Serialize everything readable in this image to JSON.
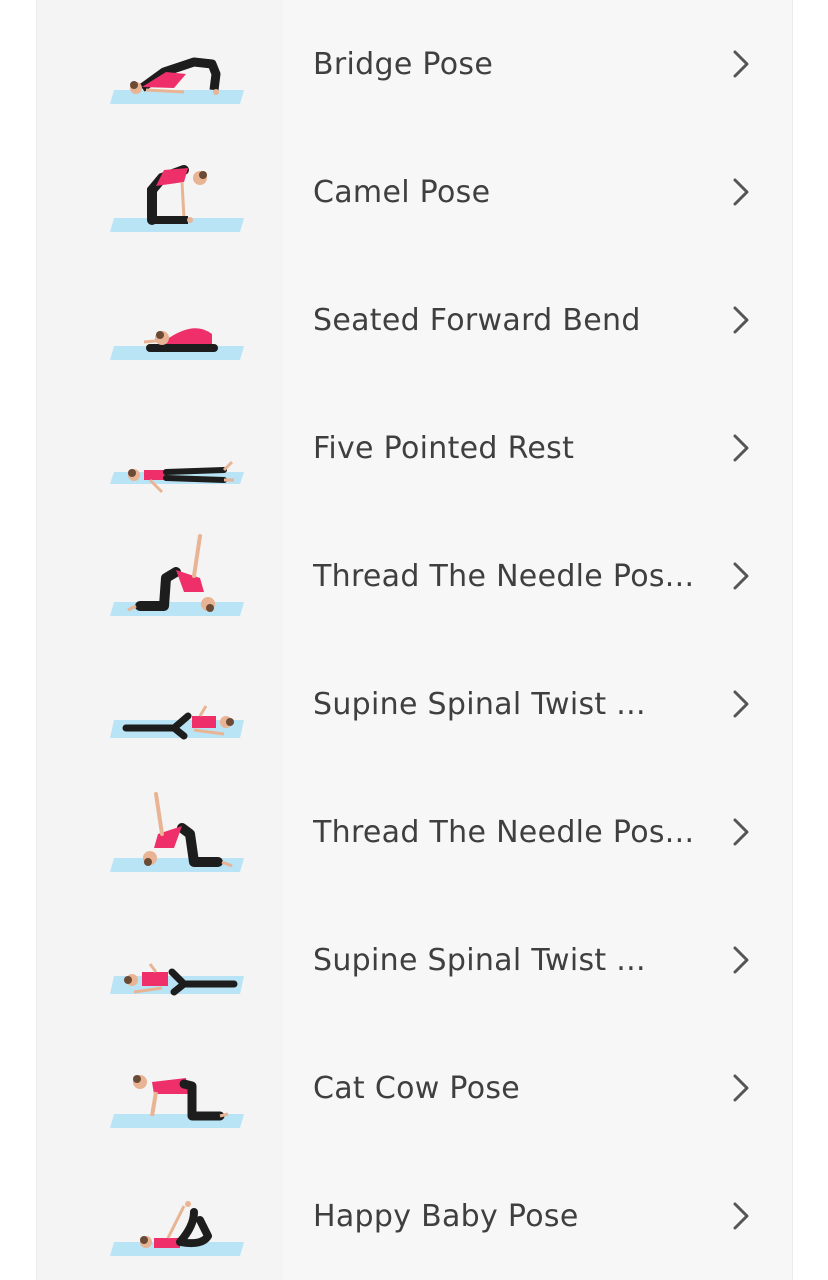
{
  "poses": [
    {
      "label": "Bridge Pose",
      "figure": "bridge"
    },
    {
      "label": "Camel Pose",
      "figure": "camel"
    },
    {
      "label": "Seated Forward Bend",
      "figure": "forward-bend"
    },
    {
      "label": "Five Pointed Rest",
      "figure": "five-pointed-rest"
    },
    {
      "label": "Thread The Needle Pos...",
      "figure": "thread-needle-right"
    },
    {
      "label": "Supine Spinal Twist ...",
      "figure": "supine-twist-right"
    },
    {
      "label": "Thread The Needle Pos...",
      "figure": "thread-needle-left"
    },
    {
      "label": "Supine Spinal Twist ...",
      "figure": "supine-twist-left"
    },
    {
      "label": "Cat Cow Pose",
      "figure": "cat-cow"
    },
    {
      "label": "Happy Baby Pose",
      "figure": "happy-baby"
    }
  ],
  "icons": {
    "row_action": "chevron-right-icon"
  },
  "colors": {
    "mat": "#b8e4f5",
    "top": "#ee2f6a",
    "pants": "#1d1d1d",
    "skin": "#e8b493",
    "hair": "#6b4a36",
    "text": "#3f3f3f",
    "chevron": "#555555"
  }
}
